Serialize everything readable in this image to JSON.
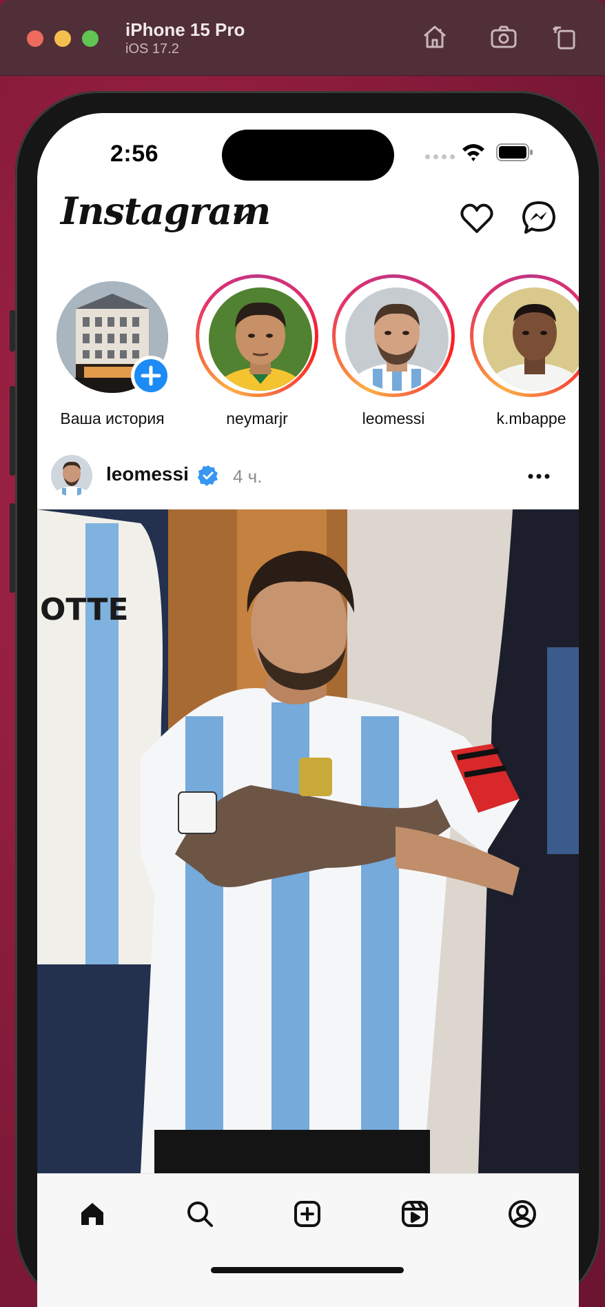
{
  "simulator": {
    "device_name": "iPhone 15 Pro",
    "os_version": "iOS 17.2",
    "icons": [
      "home-icon",
      "screenshot-icon",
      "rotate-icon"
    ]
  },
  "status_bar": {
    "time": "2:56"
  },
  "header": {
    "logo_text": "Instagram",
    "icons": [
      "chevron-down-icon",
      "heart-icon",
      "messenger-icon"
    ]
  },
  "stories": [
    {
      "label": "Ваша история",
      "own": true
    },
    {
      "label": "neymarjr"
    },
    {
      "label": "leomessi"
    },
    {
      "label": "k.mbappe"
    }
  ],
  "post": {
    "username": "leomessi",
    "verified": true,
    "time_ago": "4 ч."
  },
  "tab_bar": {
    "items": [
      "home-icon",
      "search-icon",
      "create-icon",
      "reels-icon",
      "profile-icon"
    ]
  },
  "colors": {
    "story_ring_start": "#c13584",
    "story_ring_end": "#fcaf45",
    "verified_blue": "#3897f0",
    "add_story_blue": "#1d8bf5"
  }
}
